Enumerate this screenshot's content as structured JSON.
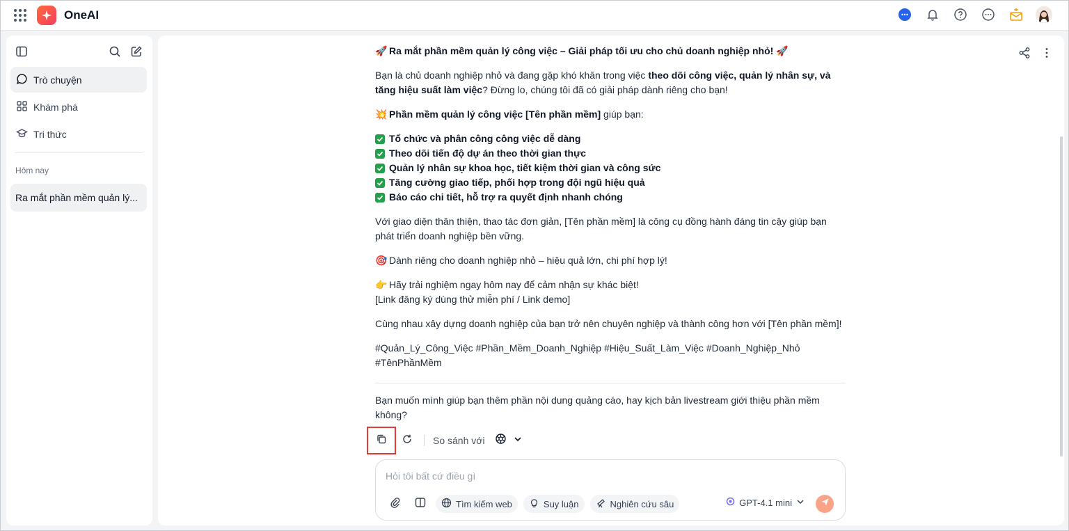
{
  "app": {
    "brand": "OneAI"
  },
  "sidebar": {
    "nav": [
      {
        "label": "Trò chuyện",
        "icon": "chat-icon",
        "active": true
      },
      {
        "label": "Khám phá",
        "icon": "grid-icon",
        "active": false
      },
      {
        "label": "Tri thức",
        "icon": "graduation-cap-icon",
        "active": false
      }
    ],
    "section_label": "Hôm nay",
    "history": [
      {
        "label": "Ra mắt phần mềm quản lý..."
      }
    ]
  },
  "message": {
    "title": "Ra mắt phần mềm quản lý công việc – Giải pháp tối ưu cho chủ doanh nghiệp nhỏ!",
    "intro_1": "Bạn là chủ doanh nghiệp nhỏ và đang gặp khó khăn trong việc ",
    "intro_bold": "theo dõi công việc, quản lý nhân sự, và tăng hiệu suất làm việc",
    "intro_2": "? Đừng lo, chúng tôi đã có giải pháp dành riêng cho bạn!",
    "feature_heading_bold": "Phần mềm quản lý công việc [Tên phần mềm]",
    "feature_heading_rest": " giúp bạn:",
    "checklist": [
      "Tổ chức và phân công công việc dễ dàng",
      "Theo dõi tiến độ dự án theo thời gian thực",
      "Quản lý nhân sự khoa học, tiết kiệm thời gian và công sức",
      "Tăng cường giao tiếp, phối hợp trong đội ngũ hiệu quả",
      "Báo cáo chi tiết, hỗ trợ ra quyết định nhanh chóng"
    ],
    "para_interface": "Với giao diện thân thiện, thao tác đơn giản, [Tên phần mềm] là công cụ đồng hành đáng tin cậy giúp bạn phát triển doanh nghiệp bền vững.",
    "para_target": "Dành riêng cho doanh nghiệp nhỏ – hiệu quả lớn, chi phí hợp lý!",
    "para_try": "Hãy trải nghiệm ngay hôm nay để cảm nhận sự khác biệt!",
    "para_link": "[Link đăng ký dùng thử miễn phí / Link demo]",
    "para_together": "Cùng nhau xây dựng doanh nghiệp của bạn trở nên chuyên nghiệp và thành công hơn với [Tên phần mềm]!",
    "hashtags_1": "#Quản_Lý_Công_Việc #Phần_Mềm_Doanh_Nghiệp #Hiệu_Suất_Làm_Việc #Doanh_Nghiệp_Nhỏ",
    "hashtags_2": "#TênPhầnMềm",
    "followup": "Bạn muốn mình giúp bạn thêm phần nội dung quảng cáo, hay kịch bản livestream giới thiệu phần mềm không?"
  },
  "toolbar": {
    "compare_label": "So sánh với"
  },
  "composer": {
    "placeholder": "Hỏi tôi bất cứ điều gì",
    "chips": [
      "Tìm kiếm web",
      "Suy luận",
      "Nghiên cứu sâu"
    ],
    "model": "GPT-4.1 mini"
  },
  "colors": {
    "accent": "#ff6a3d",
    "highlight_border": "#e53935",
    "check_green": "#22a04b"
  }
}
